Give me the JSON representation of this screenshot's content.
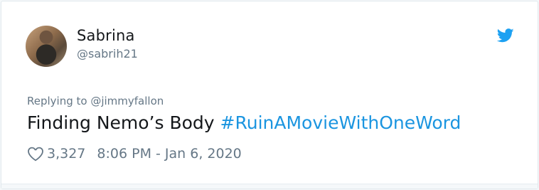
{
  "user": {
    "name": "Sabrina",
    "handle": "@sabrih21"
  },
  "reply": {
    "text": "Replying to @jimmyfallon"
  },
  "tweet": {
    "text_plain": "Finding Nemo’s Body ",
    "hashtag": "#RuinAMovieWithOneWord"
  },
  "meta": {
    "likes": "3,327",
    "time": "8:06 PM - Jan 6, 2020"
  },
  "icons": {
    "bird": "twitter-bird-icon",
    "like": "heart-icon"
  },
  "colors": {
    "accent": "#1b95e0",
    "text": "#14171a",
    "muted": "#657786"
  }
}
